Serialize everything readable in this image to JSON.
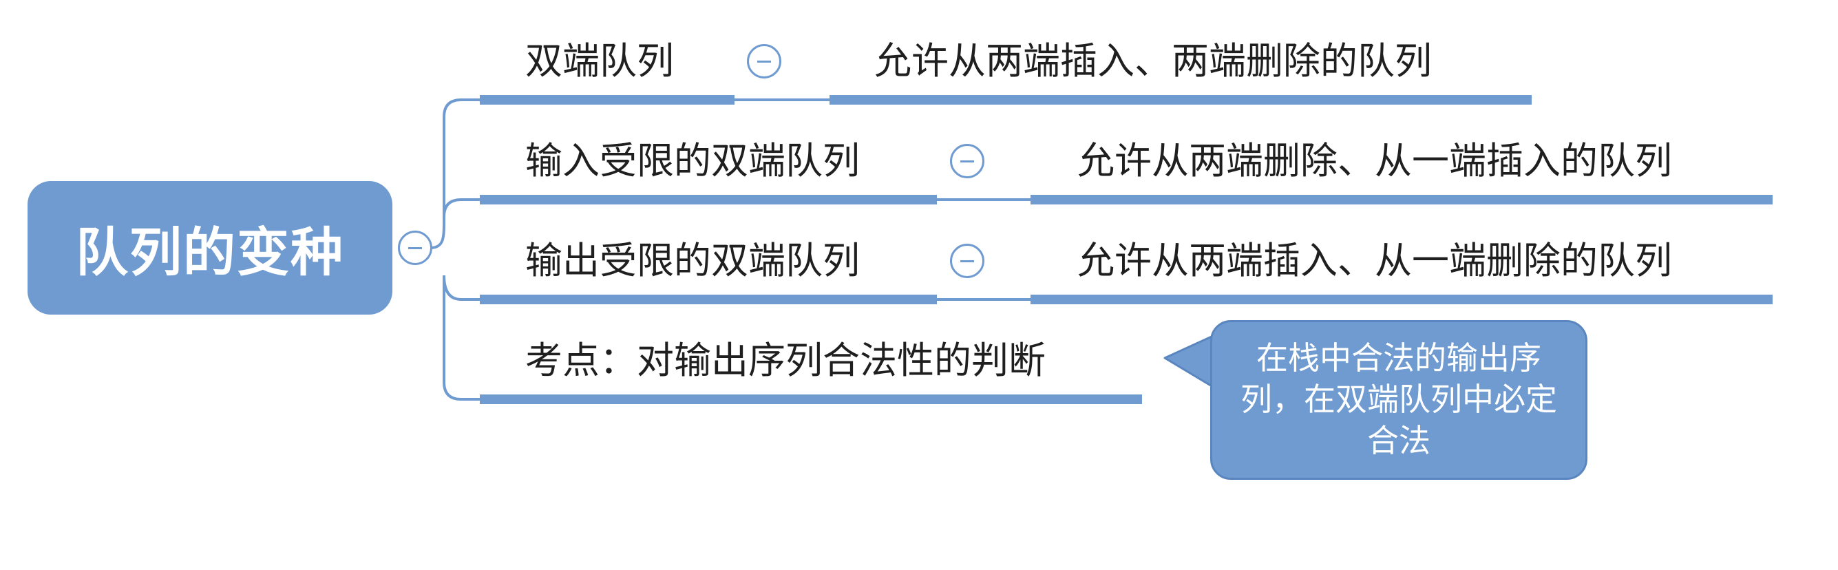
{
  "root": {
    "title": "队列的变种"
  },
  "branches": [
    {
      "label": "双端队列",
      "description": "允许从两端插入、两端删除的队列"
    },
    {
      "label": "输入受限的双端队列",
      "description": "允许从两端删除、从一端插入的队列"
    },
    {
      "label": "输出受限的双端队列",
      "description": "允许从两端插入、从一端删除的队列"
    },
    {
      "label": "考点：对输出序列合法性的判断"
    }
  ],
  "callout": {
    "text": "在栈中合法的输出序列，在双端队列中必定合法"
  },
  "colors": {
    "accent": "#6f9bd1",
    "text": "#1f1f1f",
    "background": "#ffffff"
  },
  "icons": {
    "collapse": "collapse-minus-icon"
  }
}
